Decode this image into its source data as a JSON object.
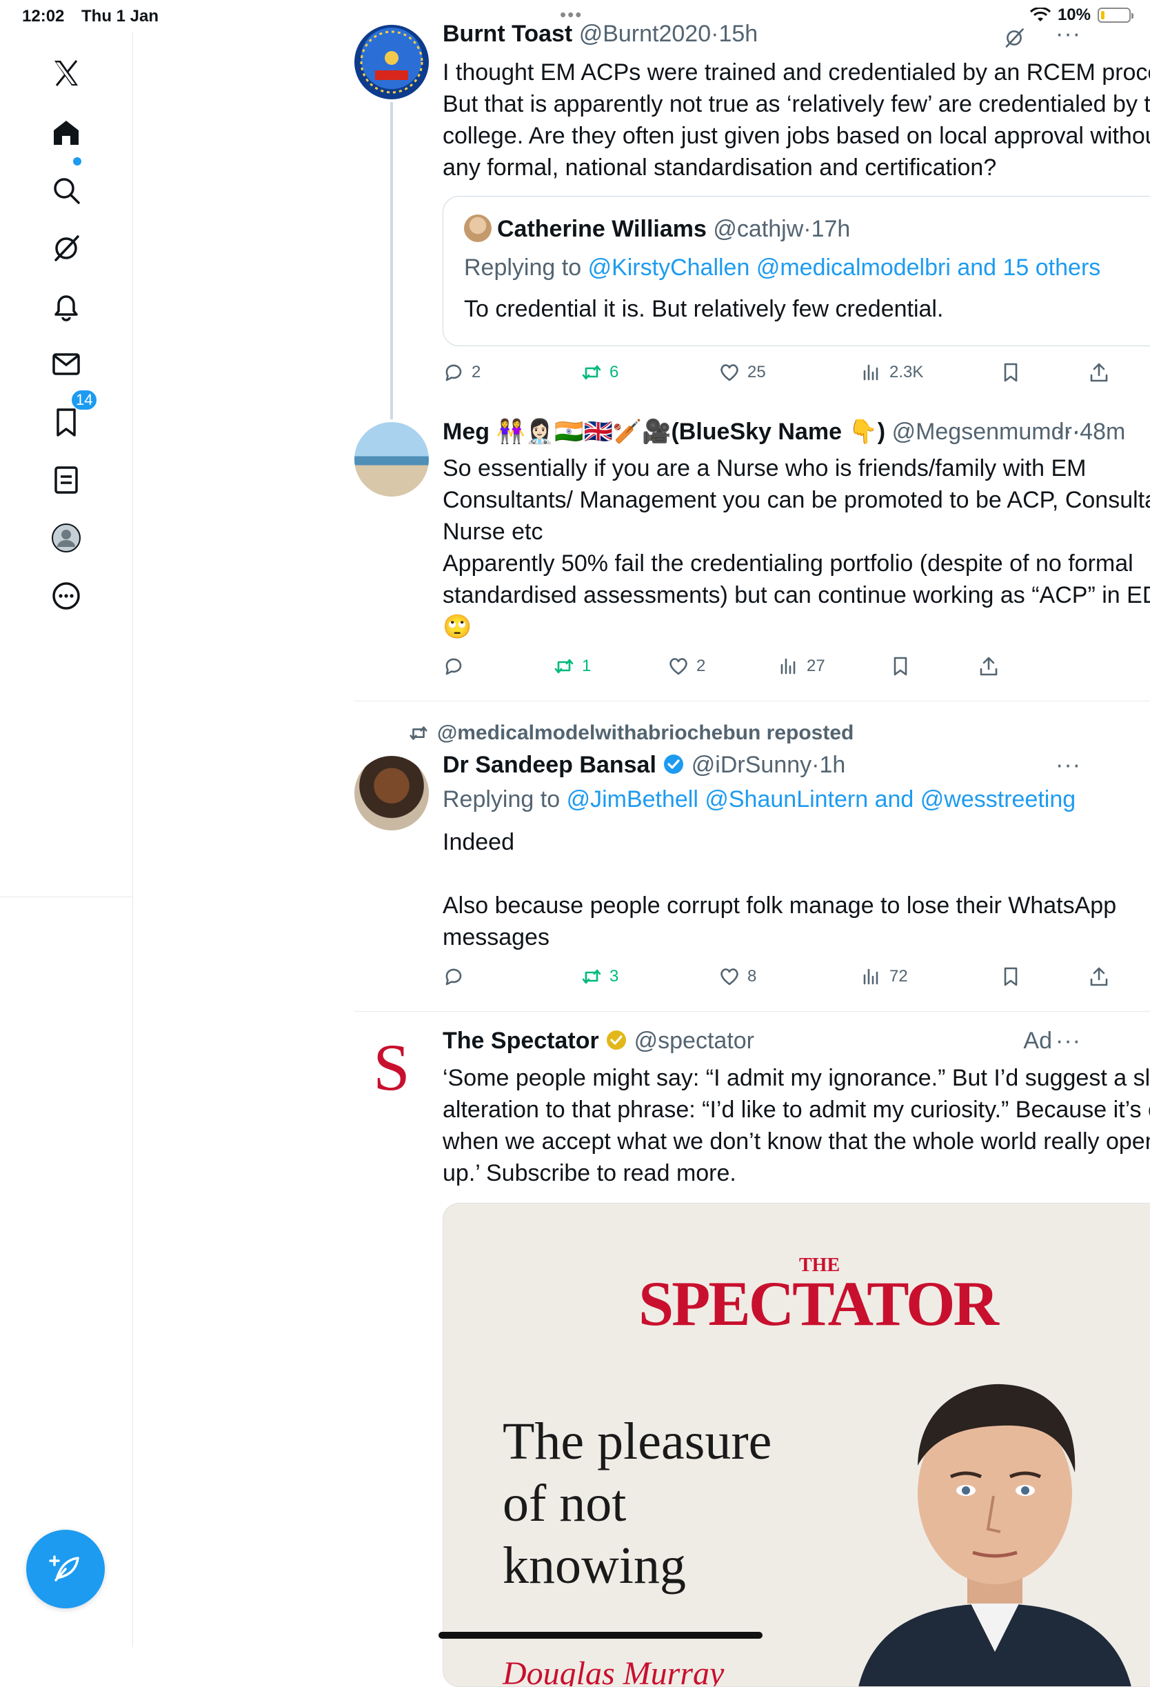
{
  "status_bar": {
    "time": "12:02",
    "date": "Thu 1 Jan",
    "battery": "10%"
  },
  "sidebar": {
    "items": [
      {
        "id": "x-logo"
      },
      {
        "id": "home"
      },
      {
        "id": "explore"
      },
      {
        "id": "grok"
      },
      {
        "id": "notifications",
        "badge": "14"
      },
      {
        "id": "messages"
      },
      {
        "id": "bookmarks"
      },
      {
        "id": "lists"
      },
      {
        "id": "profile"
      },
      {
        "id": "more"
      }
    ]
  },
  "posts": [
    {
      "name": "Burnt Toast",
      "handle": "@Burnt2020",
      "sep": "·",
      "time": "15h",
      "text": "I thought EM ACPs were trained and credentialed by an RCEM process. But that is apparently not true as ‘relatively few’ are credentialed by the college. Are they often just given jobs based on local approval without any formal, national standardisation and certification?",
      "quote": {
        "name": "Catherine Williams",
        "handle": "@cathjw",
        "sep": "·",
        "time": "17h",
        "replying_label": "Replying to",
        "replying_to": "@KirstyChallen @medicalmodelbri and 15 others",
        "text": "To credential it is. But relatively few credential."
      },
      "replies": "2",
      "reposts": "6",
      "likes": "25",
      "views": "2.3K"
    },
    {
      "name": "Meg 👭👩🏻‍⚕️🇮🇳🇬🇧🏏🎥(BlueSky Name 👇)",
      "handle": "@Megsenmumdr",
      "sep": "·",
      "time": "48m",
      "text": "So essentially if you are a Nurse who is friends/family with EM Consultants/ Management you can be promoted to be ACP, Consultant Nurse etc\nApparently 50% fail the credentialing portfolio (despite of no formal standardised assessments) but can continue working as “ACP” in ED\n🙄",
      "replies": "",
      "reposts": "1",
      "likes": "2",
      "views": "27"
    },
    {
      "repost_by": "@medicalmodelwithabriochebun reposted",
      "name": "Dr Sandeep Bansal",
      "handle": "@iDrSunny",
      "sep": "·",
      "time": "1h",
      "replying_label": "Replying to",
      "replying_to": "@JimBethell @ShaunLintern and @wesstreeting",
      "text": "Indeed\n\nAlso because people corrupt folk manage to lose their WhatsApp messages",
      "replies": "",
      "reposts": "3",
      "likes": "8",
      "views": "72"
    },
    {
      "name": "The Spectator",
      "handle": "@spectator",
      "ad_label": "Ad",
      "text": "‘Some people might say: “I admit my ignorance.” But I’d suggest a slight alteration to that phrase: “I’d like to admit my curiosity.” Because it’s only when we accept what we don’t know that the whole world really opens up.’ Subscribe to read more.",
      "card": {
        "masthead_small": "THE",
        "masthead": "SPECTATOR",
        "title": "The pleasure\nof not\nknowing",
        "author": "Douglas Murray"
      }
    }
  ],
  "avatar_letter": "S",
  "colors": {
    "accent": "#1d9bf0",
    "repost": "#00ba7c",
    "muted": "#536471",
    "spectator_red": "#c8102e"
  }
}
